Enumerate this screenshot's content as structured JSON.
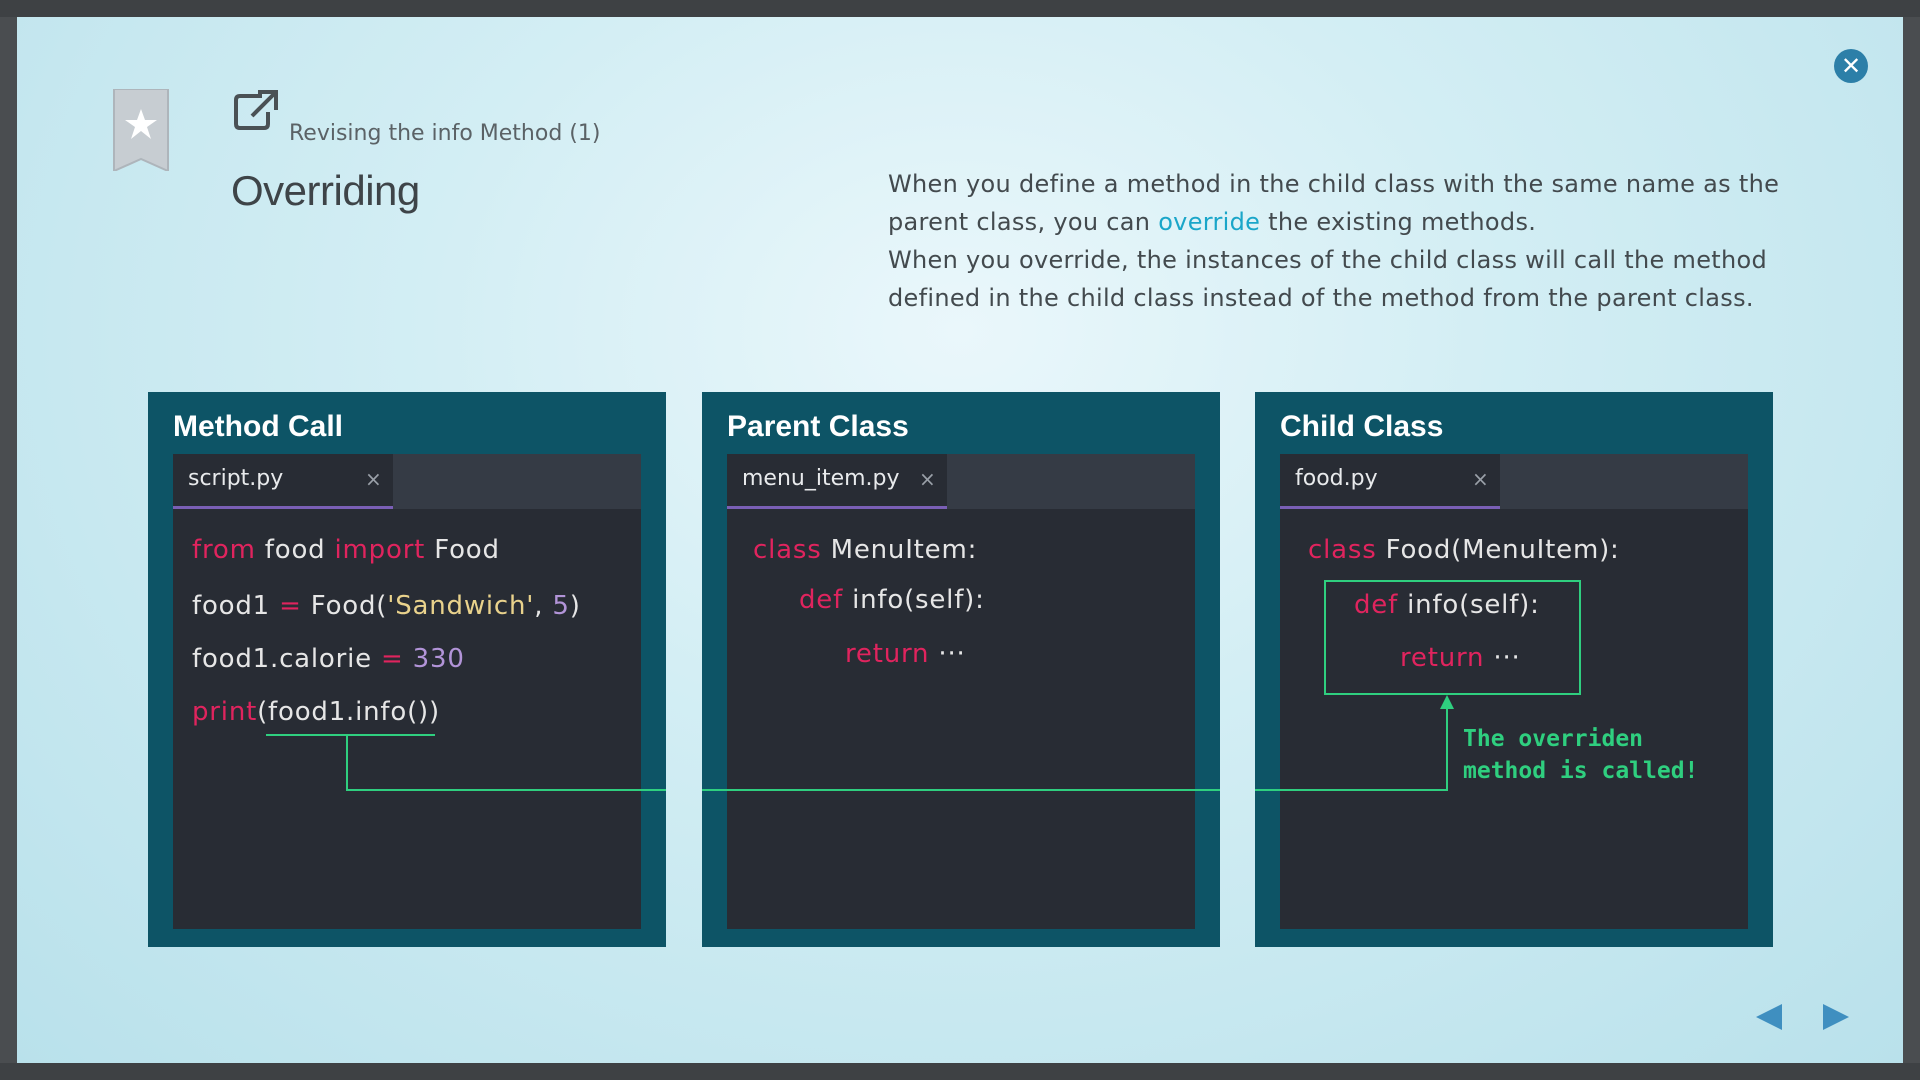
{
  "slide": {
    "subtitle": "Revising the info Method (1)",
    "title": "Overriding",
    "description": {
      "part1": "When you define a method in the child class with the same name as the parent class, you can ",
      "highlight": "override",
      "part2": " the existing methods.",
      "part3": "When you override, the instances of the child class will call the method defined in the child class instead of the method from the parent class."
    }
  },
  "panels": {
    "method_call": {
      "title": "Method Call",
      "tab": "script.py",
      "close": "×",
      "lines": [
        {
          "kw1": "from",
          "t1": " food ",
          "kw2": "import",
          "t2": " Food"
        },
        {
          "t1": "food1 ",
          "op": "=",
          "t2": " Food(",
          "str": "'Sandwich'",
          "t3": ", ",
          "num": "5",
          "t4": ")"
        },
        {
          "t1": "food1.calorie ",
          "op": "=",
          "num": " 330"
        },
        {
          "kw": "print",
          "t1": "(food1.info())"
        }
      ]
    },
    "parent_class": {
      "title": "Parent Class",
      "tab": "menu_item.py",
      "close": "×",
      "lines": [
        {
          "kw": "class",
          "t": " MenuItem:"
        },
        {
          "kw": "def",
          "t": " info(self):"
        },
        {
          "kw": "return",
          "t": " ···"
        }
      ]
    },
    "child_class": {
      "title": "Child Class",
      "tab": "food.py",
      "close": "×",
      "lines": [
        {
          "kw": "class",
          "t": " Food(MenuItem):"
        },
        {
          "kw": "def",
          "t": " info(self):"
        },
        {
          "kw": "return",
          "t": " ···"
        }
      ],
      "note": "The overriden\nmethod is called!"
    }
  },
  "icons": {
    "close": "close-icon",
    "bookmark": "bookmark-star-icon",
    "external": "external-link-icon",
    "prev": "triangle-left-icon",
    "next": "triangle-right-icon"
  },
  "colors": {
    "panel_bg": "#0d5466",
    "editor_bg": "#282c34",
    "keyword": "#e0245e",
    "string": "#e9d28c",
    "number": "#b294d8",
    "arrow": "#2fcf7f",
    "link": "#1aa6c9"
  }
}
